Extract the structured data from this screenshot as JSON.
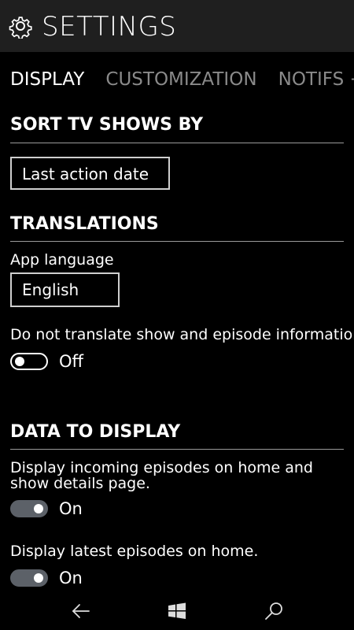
{
  "header": {
    "title": "SETTINGS",
    "icon": "gear-icon"
  },
  "tabs": [
    {
      "label": "DISPLAY",
      "active": true
    },
    {
      "label": "CUSTOMIZATION",
      "active": false
    },
    {
      "label": "NOTIFS + TILE",
      "active": false
    }
  ],
  "sort_section": {
    "title": "SORT TV SHOWS BY",
    "select_value": "Last action date"
  },
  "translations_section": {
    "title": "TRANSLATIONS",
    "app_language_label": "App language",
    "app_language_value": "English",
    "no_translate_label": "Do not translate show and episode information.",
    "no_translate_state": "Off"
  },
  "data_section": {
    "title": "DATA TO DISPLAY",
    "incoming_label": "Display incoming episodes on home and show details page.",
    "incoming_state": "On",
    "latest_label": "Display latest episodes on home.",
    "latest_state": "On"
  },
  "navbar": {
    "back_icon": "back-arrow-icon",
    "home_icon": "windows-icon",
    "search_icon": "search-icon"
  },
  "colors": {
    "background": "#000000",
    "header_bg": "#1f1f1f",
    "inactive_tab": "#8a8a8a",
    "toggle_on": "#5c6168"
  }
}
